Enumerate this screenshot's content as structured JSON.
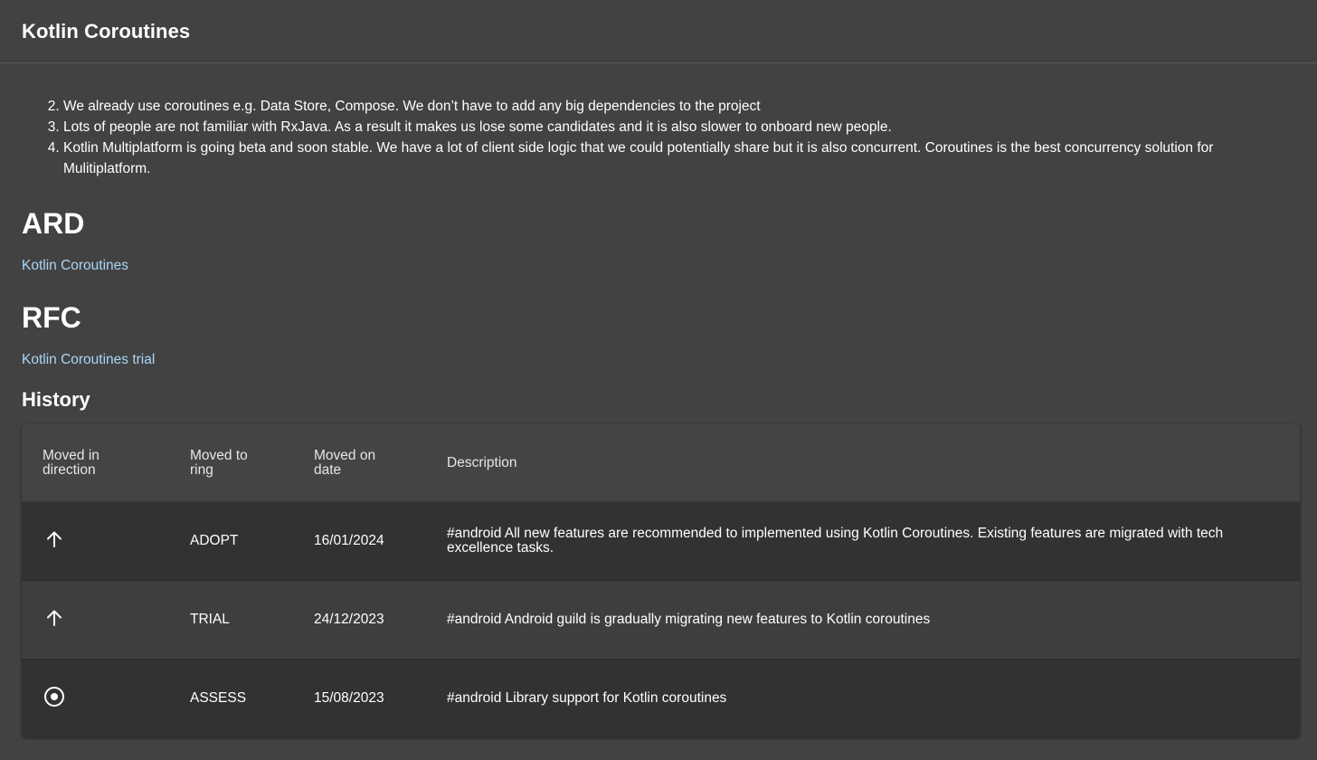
{
  "header": {
    "title": "Kotlin Coroutines"
  },
  "reasons": {
    "start": 2,
    "items": [
      "We already use coroutines e.g. Data Store, Compose. We don’t have to add any big dependencies to the project",
      "Lots of people are not familiar with RxJava. As a result it makes us lose some candidates and it is also slower to onboard new people.",
      "Kotlin Multiplatform is going beta and soon stable. We have a lot of client side logic that we could potentially share but it is also concurrent. Coroutines is the best concurrency solution for Mulitiplatform."
    ]
  },
  "ard": {
    "heading": "ARD",
    "link": "Kotlin Coroutines"
  },
  "rfc": {
    "heading": "RFC",
    "link": "Kotlin Coroutines trial"
  },
  "history": {
    "heading": "History",
    "columns": [
      "Moved in direction",
      "Moved to ring",
      "Moved on date",
      "Description"
    ],
    "rows": [
      {
        "direction_icon": "arrow-up-icon",
        "ring": "ADOPT",
        "date": "16/01/2024",
        "description": "#android All new features are recommended to implemented using Kotlin Coroutines. Existing features are migrated with tech excellence tasks."
      },
      {
        "direction_icon": "arrow-up-icon",
        "ring": "TRIAL",
        "date": "24/12/2023",
        "description": "#android Android guild is gradually migrating new features to Kotlin coroutines"
      },
      {
        "direction_icon": "circle-dot-icon",
        "ring": "ASSESS",
        "date": "15/08/2023",
        "description": "#android Library support for Kotlin coroutines"
      }
    ]
  },
  "colors": {
    "background": "#424242",
    "link": "#a9d6f5",
    "row_dark": "#323232",
    "row_light": "#3e3e3e"
  }
}
